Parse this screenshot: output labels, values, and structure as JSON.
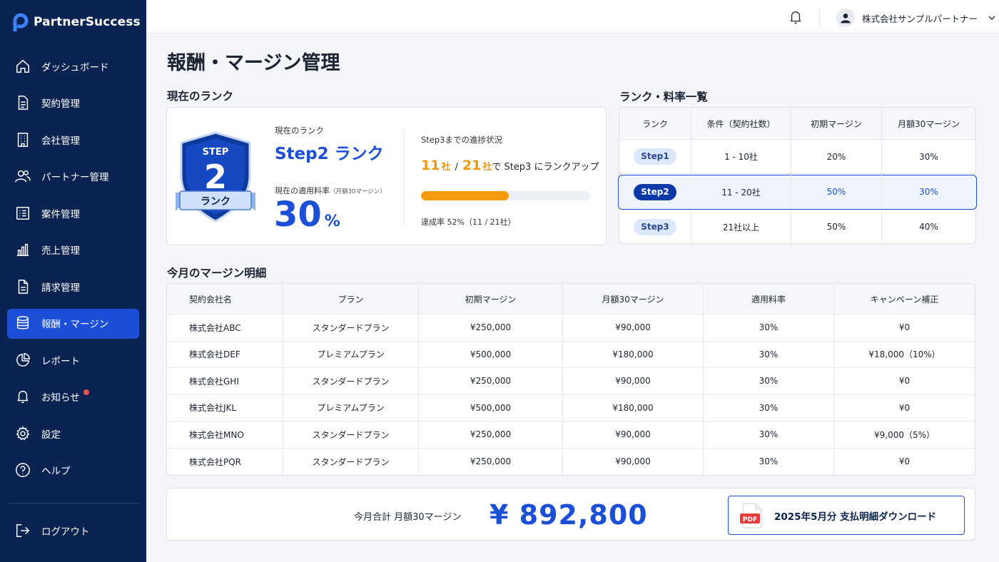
{
  "app": {
    "name": "PartnerSuccess"
  },
  "sidebar": {
    "items": [
      {
        "label": "ダッシュボード",
        "icon": "home-icon"
      },
      {
        "label": "契約管理",
        "icon": "document-icon"
      },
      {
        "label": "会社管理",
        "icon": "building-icon"
      },
      {
        "label": "パートナー管理",
        "icon": "users-icon"
      },
      {
        "label": "案件管理",
        "icon": "list-icon"
      },
      {
        "label": "売上管理",
        "icon": "bar-chart-icon"
      },
      {
        "label": "請求管理",
        "icon": "invoice-icon"
      },
      {
        "label": "報酬・マージン",
        "icon": "coins-icon",
        "active": true
      },
      {
        "label": "レポート",
        "icon": "pie-chart-icon"
      },
      {
        "label": "お知らせ",
        "icon": "bell-icon",
        "has_notification": true
      },
      {
        "label": "設定",
        "icon": "gear-icon"
      },
      {
        "label": "ヘルプ",
        "icon": "help-icon"
      }
    ],
    "logout_label": "ログアウト"
  },
  "topbar": {
    "user_name": "株式会社サンプルパートナー"
  },
  "page": {
    "title": "報酬・マージン管理"
  },
  "current_rank": {
    "section_title": "現在のランク",
    "badge_step": "STEP",
    "badge_number": "2",
    "badge_rank": "ランク",
    "label": "現在のランク",
    "value": "Step2 ランク",
    "rate_label": "現在の適用料率",
    "rate_sublabel": "（月額30マージン）",
    "rate_value": "30",
    "rate_unit": "%",
    "progress_title": "Step3までの進捗状況",
    "current_count": "11",
    "target_count": "21",
    "count_unit": "社",
    "separator": "/",
    "progress_suffix": "で Step3 にランクアップ",
    "progress_percent": 52,
    "progress_note": "達成率 52%（11 / 21社）"
  },
  "rate_table": {
    "section_title": "ランク・料率一覧",
    "headers": [
      "ランク",
      "条件（契約社数）",
      "初期マージン",
      "月額30マージン"
    ],
    "rows": [
      {
        "rank": "Step1",
        "condition": "1 - 10社",
        "initial": "20%",
        "monthly": "30%"
      },
      {
        "rank": "Step2",
        "condition": "11 - 20社",
        "initial": "50%",
        "monthly": "30%",
        "highlighted": true
      },
      {
        "rank": "Step3",
        "condition": "21社以上",
        "initial": "50%",
        "monthly": "40%"
      }
    ]
  },
  "detail_table": {
    "section_title": "今月のマージン明細",
    "headers": [
      "契約会社名",
      "プラン",
      "初期マージン",
      "月額30マージン",
      "適用料率",
      "キャンペーン補正"
    ],
    "rows": [
      [
        "株式会社ABC",
        "スタンダードプラン",
        "¥250,000",
        "¥90,000",
        "30%",
        "¥0"
      ],
      [
        "株式会社DEF",
        "プレミアムプラン",
        "¥500,000",
        "¥180,000",
        "30%",
        "¥18,000（10%）"
      ],
      [
        "株式会社GHI",
        "スタンダードプラン",
        "¥250,000",
        "¥90,000",
        "30%",
        "¥0"
      ],
      [
        "株式会社JKL",
        "プレミアムプラン",
        "¥500,000",
        "¥180,000",
        "30%",
        "¥0"
      ],
      [
        "株式会社MNO",
        "スタンダードプラン",
        "¥250,000",
        "¥90,000",
        "30%",
        "¥9,000（5%）"
      ],
      [
        "株式会社PQR",
        "スタンダードプラン",
        "¥250,000",
        "¥90,000",
        "30%",
        "¥0"
      ]
    ]
  },
  "total": {
    "label": "今月合計  月額30マージン",
    "value": "¥ 892,800",
    "download_label": "2025年5月分 支払明細ダウンロード",
    "pdf_label": "PDF"
  },
  "colors": {
    "sidebar": "#0b2350",
    "accent": "#1a4fd6",
    "orange": "#f59a0f"
  }
}
